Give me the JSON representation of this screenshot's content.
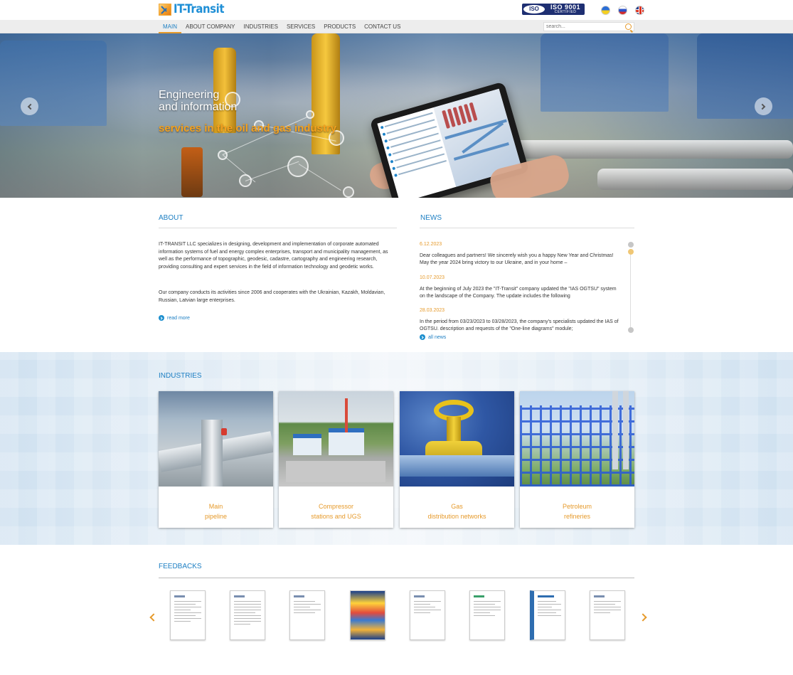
{
  "header": {
    "logo_text": "IT-Transit",
    "iso_badge": {
      "mark": "ISO",
      "title": "ISO 9001",
      "subtitle": "CERTIFIED"
    },
    "languages": [
      "Ukrainian",
      "Russian",
      "English"
    ]
  },
  "nav": {
    "items": [
      "MAIN",
      "ABOUT COMPANY",
      "INDUSTRIES",
      "SERVICES",
      "PRODUCTS",
      "CONTACT US"
    ],
    "active_index": 0
  },
  "search": {
    "placeholder": "search..."
  },
  "hero": {
    "title_line1": "Engineering",
    "title_line2": "and information",
    "subtitle": "services in the oil and gas industry"
  },
  "about": {
    "title": "ABOUT",
    "paragraph1": "IT-TRANSIT LLC  specializes in designing, development and implementation of corporate automated information systems of fuel and energy complex enterprises, transport and municipality management, as well as the performance of topographic, geodesic, cadastre, cartography and engineering research, providing consulting and expert services in the field of information technology and geodetic works.",
    "paragraph2": "Our company conducts its activities since 2006 and cooperates with the Ukrainian, Kazakh, Moldavian, Russian, Latvian large enterprises.",
    "read_more": "read more"
  },
  "news": {
    "title": "NEWS",
    "items": [
      {
        "date": "6.12.2023",
        "text": "Dear colleagues and partners! We sincerely wish you a happy New Year and Christmas! May the year 2024 bring victory to our Ukraine, and in your home –"
      },
      {
        "date": "10.07.2023",
        "text": "    At the beginning of July 2023 the \"IT-Transit\" company updated the \"IAS OGTSU\" system on the landscape of the Company. The update includes the following"
      },
      {
        "date": "28.03.2023",
        "text": "   In the period from 03/23/2023 to 03/28/2023, the company's specialists updated the IAS of OGTSU.  description and requests of the \"One-line diagrams\" module;"
      }
    ],
    "all_news": "all news"
  },
  "industries": {
    "title": "INDUSTRIES",
    "cards": [
      {
        "line1": "Main",
        "line2": "pipeline"
      },
      {
        "line1": "Compressor",
        "line2": "stations and UGS"
      },
      {
        "line1": "Gas",
        "line2": "distribution networks"
      },
      {
        "line1": "Petroleum",
        "line2": "refineries"
      }
    ]
  },
  "feedbacks": {
    "title": "FEEDBACKS",
    "count": 8
  },
  "colors": {
    "brand_blue": "#1d7fc3",
    "accent_orange": "#e69a2b"
  }
}
